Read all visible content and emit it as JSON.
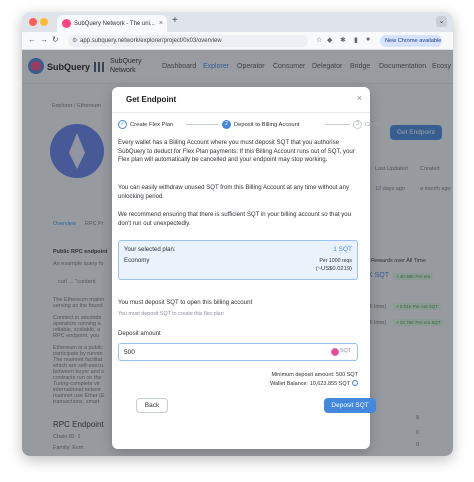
{
  "browser": {
    "tab_title": "SubQuery Network - The uni...",
    "tab_close": "×",
    "new_tab": "+",
    "url": "app.subquery.network/explorer/project/0x03/overview",
    "new_chrome_badge": "New Chrome available"
  },
  "site": {
    "logo_text": "SubQuery",
    "app_name": "SubQuery Network",
    "nav": [
      "Dashboard",
      "Explorer",
      "Operator",
      "Consumer",
      "Delegator",
      "Bridge",
      "Documentation",
      "Ecosy"
    ]
  },
  "background": {
    "breadcrumb": "Explorer / Ethereum",
    "get_endpoint_button": "Get Endpoint",
    "tabs": [
      "Overview",
      "RPC Pr"
    ],
    "public_rpc": "Public RPC endpoint",
    "example_query": "An example query fo",
    "curl_snippet": "curl → \"content",
    "desc_lines": [
      "The Ethereum mainn",
      "serving as the found",
      "Connect in seconds",
      "operators running a",
      "reliable, scalable, a",
      "RPC endpoint, you",
      "Ethereum is a public",
      "participate by runnin",
      "The mainnet facilitat",
      "which are self-execu",
      "between buyer and s",
      "contracts run on the",
      "Turing-complete vir",
      "international networ",
      "mainnet use Ether (E",
      "transactions, smart"
    ],
    "rpc_endpoint": "RPC Endpoint",
    "chain_id": "Chain ID: 1",
    "family": "Family: Evm",
    "node_type": "Node type: Full",
    "last_updated_label": "Last Updated",
    "last_updated_value": "13 days ago",
    "created_label": "Created",
    "created_value": "a month ago",
    "rewards_title": "t Rewards over All Time",
    "rewards_value": "K SQT",
    "pill_1": "+ 40.36K Per era",
    "pill_2": "+ 0.01K Per era SQT",
    "pill_3": "+ 24.76K Per era SQT",
    "all_time_1": "ll time)",
    "all_time_2": "ll time)",
    "numbers": [
      "8",
      "0",
      "0"
    ]
  },
  "modal": {
    "title": "Get Endpoint",
    "close": "×",
    "steps": [
      {
        "label": "Create Flex Plan",
        "marker": "✓"
      },
      {
        "label": "Deposit to Billing Account",
        "marker": "2"
      },
      {
        "label": "Confirm",
        "marker": "3"
      }
    ],
    "paragraph_1": "Every wallet has a Billing Account where you must deposit SQT that you authorise SubQuery to deduct for Flex Plan payments. If this Billing Account runs out of SQT, your Flex plan will automatically be cancelled and your endpoint may stop working.",
    "paragraph_2": "You can easily withdraw unused SQT from this Billing Account at any time without any unlocking period.",
    "paragraph_3": "We recommend ensuring that there is sufficient SQT in your billing account so that you don't run out unexpectedly.",
    "plan": {
      "label": "Your selected plan:",
      "sqt": "1 SQT",
      "name": "Economy",
      "per": "Per 1000 reqs",
      "usd": "(~US$0.0219)"
    },
    "must_deposit": "You must deposit SQT to open this billing account",
    "must_deposit_sub": "You must deposit SQT to create this flex plan",
    "deposit_label": "Deposit amount",
    "deposit_value": "500",
    "deposit_suffix": "SQT",
    "min_deposit": "Minimum deposit amount: 500 SQT",
    "wallet_balance": "Wallet Balance: 10,623.855 SQT",
    "back_button": "Back",
    "deposit_button": "Deposit SQT"
  },
  "colors": {
    "accent": "#4388dd",
    "brand_pink": "#ff4581",
    "plan_bg": "#eaf2fc",
    "overlay": "rgba(40,44,52,0.45)"
  }
}
